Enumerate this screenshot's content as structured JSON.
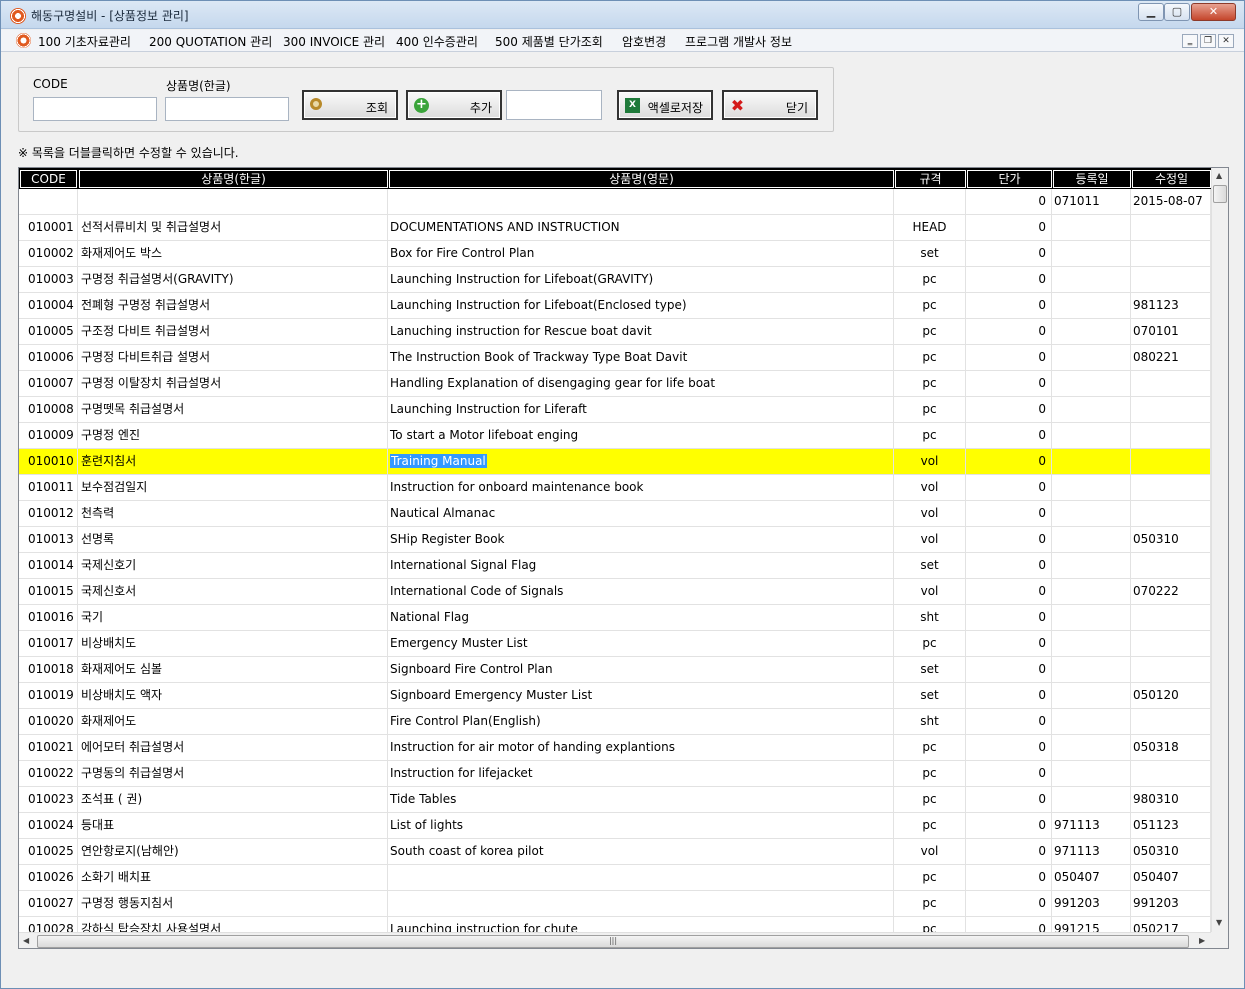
{
  "window": {
    "title": "해동구명설비 - [상품정보 관리]",
    "controls": {
      "minimize": "▁",
      "maximize": "▢",
      "close": "✕"
    },
    "mdi_controls": {
      "minimize": "‗",
      "restore": "❐",
      "close": "✕"
    }
  },
  "menu": [
    "100 기초자료관리",
    "200 QUOTATION 관리",
    "300 INVOICE 관리",
    "400 인수증관리",
    "500 제품별 단가조회",
    "암호변경",
    "프로그램 개발사 정보"
  ],
  "search": {
    "code_label": "CODE",
    "code_value": "",
    "name_label": "상품명(한글)",
    "name_value": "",
    "extra_value": ""
  },
  "buttons": {
    "search": "조회",
    "add": "추가",
    "excel": "액셀로저장",
    "close": "닫기"
  },
  "hint": "※ 목록을 더블클릭하면 수정할 수 있습니다.",
  "grid": {
    "columns": [
      "CODE",
      "상품명(한글)",
      "상품명(영문)",
      "규격",
      "단가",
      "등록일",
      "수정일"
    ],
    "selected_row": 10,
    "rows": [
      [
        "",
        "",
        "",
        "",
        "0",
        "071011",
        "2015-08-07"
      ],
      [
        "010001",
        "선적서류비치 및 취급설명서",
        "DOCUMENTATIONS AND INSTRUCTION",
        "HEAD",
        "0",
        "",
        ""
      ],
      [
        "010002",
        "화재제어도 박스",
        "Box for Fire Control Plan",
        "set",
        "0",
        "",
        ""
      ],
      [
        "010003",
        "구명정 취급설명서(GRAVITY)",
        "Launching Instruction for Lifeboat(GRAVITY)",
        "pc",
        "0",
        "",
        ""
      ],
      [
        "010004",
        "전폐형 구명정 취급설명서",
        "Launching Instruction for Lifeboat(Enclosed type)",
        "pc",
        "0",
        "",
        "981123"
      ],
      [
        "010005",
        "구조정 다비트 취급설명서",
        "Lanuching instruction for Rescue boat davit",
        "pc",
        "0",
        "",
        "070101"
      ],
      [
        "010006",
        "구명정 다비트취급 설명서",
        "The Instruction Book of Trackway Type Boat Davit",
        "pc",
        "0",
        "",
        "080221"
      ],
      [
        "010007",
        "구명정 이탈장치 취급설명서",
        "Handling Explanation of disengaging gear for life boat",
        "pc",
        "0",
        "",
        ""
      ],
      [
        "010008",
        "구명뗏목 취급설명서",
        "Launching Instruction for Liferaft",
        "pc",
        "0",
        "",
        ""
      ],
      [
        "010009",
        "구명정 엔진",
        "To start a Motor lifeboat enging",
        "pc",
        "0",
        "",
        ""
      ],
      [
        "010010",
        "훈련지침서",
        "Training Manual",
        "vol",
        "0",
        "",
        ""
      ],
      [
        "010011",
        "보수점검일지",
        "Instruction for onboard maintenance book",
        "vol",
        "0",
        "",
        ""
      ],
      [
        "010012",
        "천측력",
        "Nautical Almanac",
        "vol",
        "0",
        "",
        ""
      ],
      [
        "010013",
        "선명록",
        "SHip Register Book",
        "vol",
        "0",
        "",
        "050310"
      ],
      [
        "010014",
        "국제신호기",
        "International Signal Flag",
        "set",
        "0",
        "",
        ""
      ],
      [
        "010015",
        "국제신호서",
        "International Code of Signals",
        "vol",
        "0",
        "",
        "070222"
      ],
      [
        "010016",
        "국기",
        "National Flag",
        "sht",
        "0",
        "",
        ""
      ],
      [
        "010017",
        "비상배치도",
        "Emergency Muster List",
        "pc",
        "0",
        "",
        ""
      ],
      [
        "010018",
        "화재제어도 심볼",
        "Signboard Fire Control Plan",
        "set",
        "0",
        "",
        ""
      ],
      [
        "010019",
        "비상배치도 액자",
        "Signboard Emergency Muster List",
        "set",
        "0",
        "",
        "050120"
      ],
      [
        "010020",
        "화재제어도",
        "Fire Control Plan(English)",
        "sht",
        "0",
        "",
        ""
      ],
      [
        "010021",
        "에어모터 취급설명서",
        "Instruction for air motor of handing explantions",
        "pc",
        "0",
        "",
        "050318"
      ],
      [
        "010022",
        "구명동의 취급설명서",
        "Instruction for lifejacket",
        "pc",
        "0",
        "",
        ""
      ],
      [
        "010023",
        "조석표 (     권)",
        "Tide Tables",
        "pc",
        "0",
        "",
        "980310"
      ],
      [
        "010024",
        "등대표",
        "List of lights",
        "pc",
        "0",
        "971113",
        "051123"
      ],
      [
        "010025",
        "연안항로지(남해안)",
        "South coast of korea pilot",
        "vol",
        "0",
        "971113",
        "050310"
      ],
      [
        "010026",
        "소화기 배치표",
        "",
        "pc",
        "0",
        "050407",
        "050407"
      ],
      [
        "010027",
        "구명정 행동지침서",
        "",
        "pc",
        "0",
        "991203",
        "991203"
      ],
      [
        "010028",
        "강하식 탑승장치 사용설명서",
        "Launching instruction for chute",
        "pc",
        "0",
        "991215",
        "050217"
      ]
    ]
  },
  "scroll": {
    "up": "▲",
    "down": "▼",
    "left": "◀",
    "right": "▶",
    "grip": "|||"
  }
}
